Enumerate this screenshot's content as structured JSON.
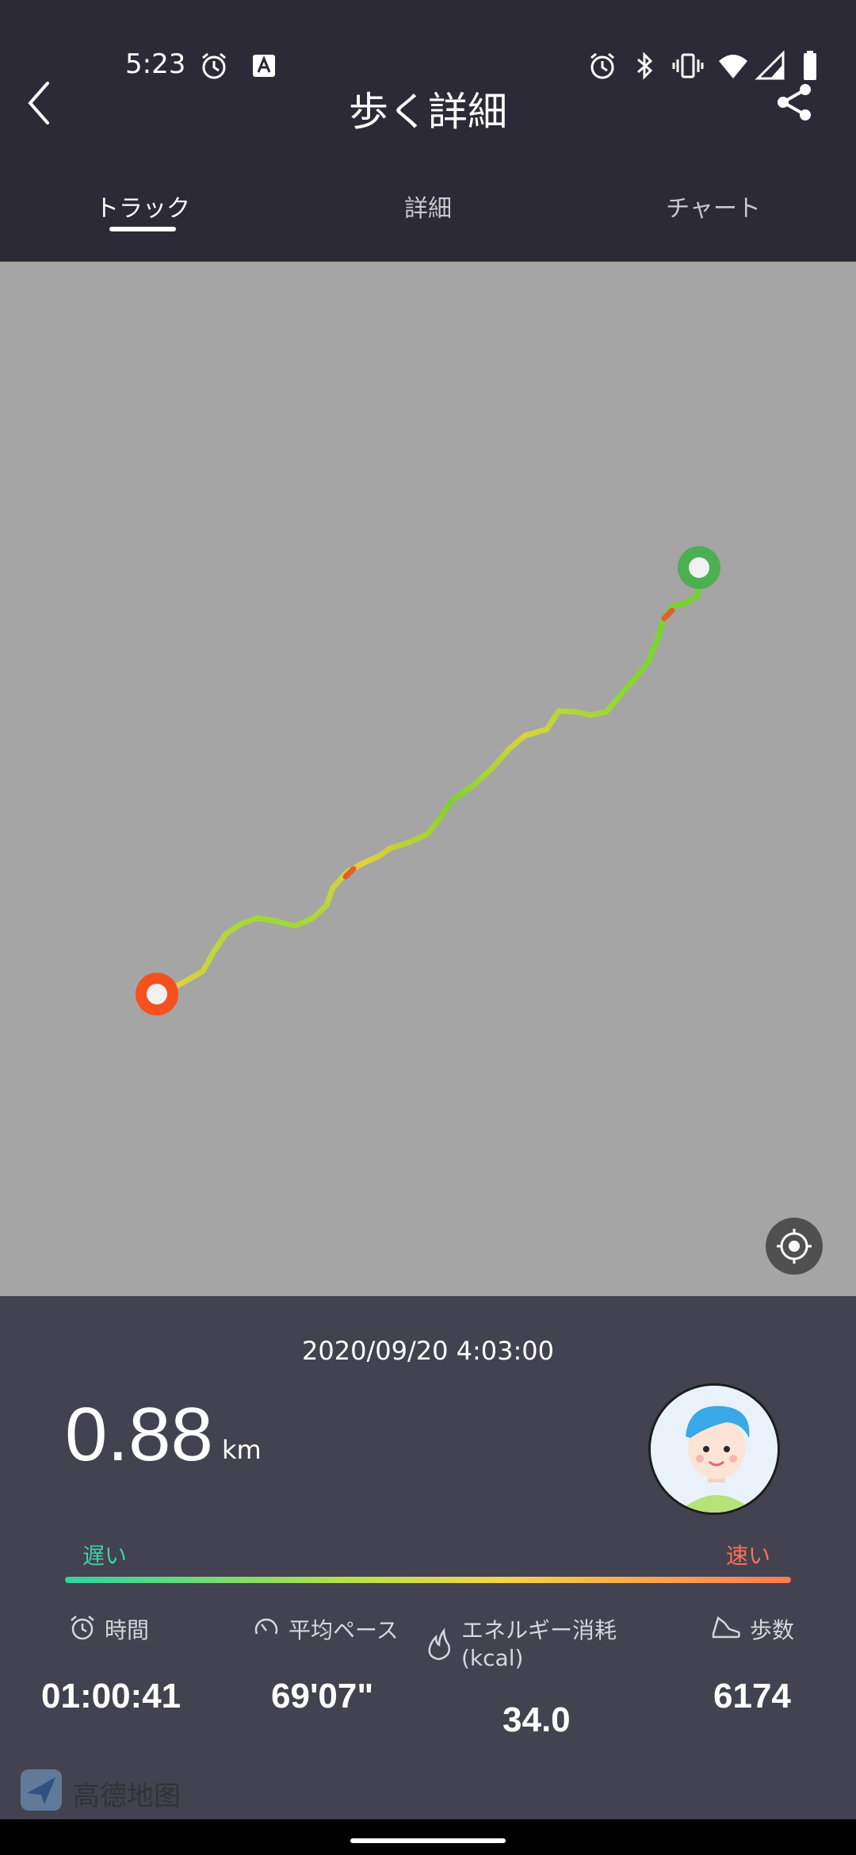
{
  "status_bar": {
    "time": "5:23"
  },
  "header": {
    "title": "歩く詳細"
  },
  "tabs": [
    {
      "label": "トラック",
      "active": true
    },
    {
      "label": "詳細",
      "active": false
    },
    {
      "label": "チャート",
      "active": false
    }
  ],
  "map": {
    "attribution": "高德地图"
  },
  "summary": {
    "datetime": "2020/09/20 4:03:00",
    "distance": "0.88",
    "distance_unit": "km",
    "legend_slow": "遅い",
    "legend_fast": "速い"
  },
  "stats": [
    {
      "label": "時間",
      "value": "01:00:41",
      "icon": "alarm-clock-icon"
    },
    {
      "label": "平均ペース",
      "value": "69'07\"",
      "icon": "speedometer-icon"
    },
    {
      "label": "エネルギー消耗",
      "sublabel": "(kcal)",
      "value": "34.0",
      "icon": "flame-icon"
    },
    {
      "label": "歩数",
      "value": "6174",
      "icon": "shoe-icon"
    }
  ],
  "colors": {
    "header_bg": "#2b2a36",
    "map_bg": "#a5a5a5",
    "panel_bg": "#434250",
    "start_marker": "#4caf50",
    "end_marker": "#f4511e",
    "slow": "#3ed0a4",
    "fast": "#ff6f5a"
  }
}
